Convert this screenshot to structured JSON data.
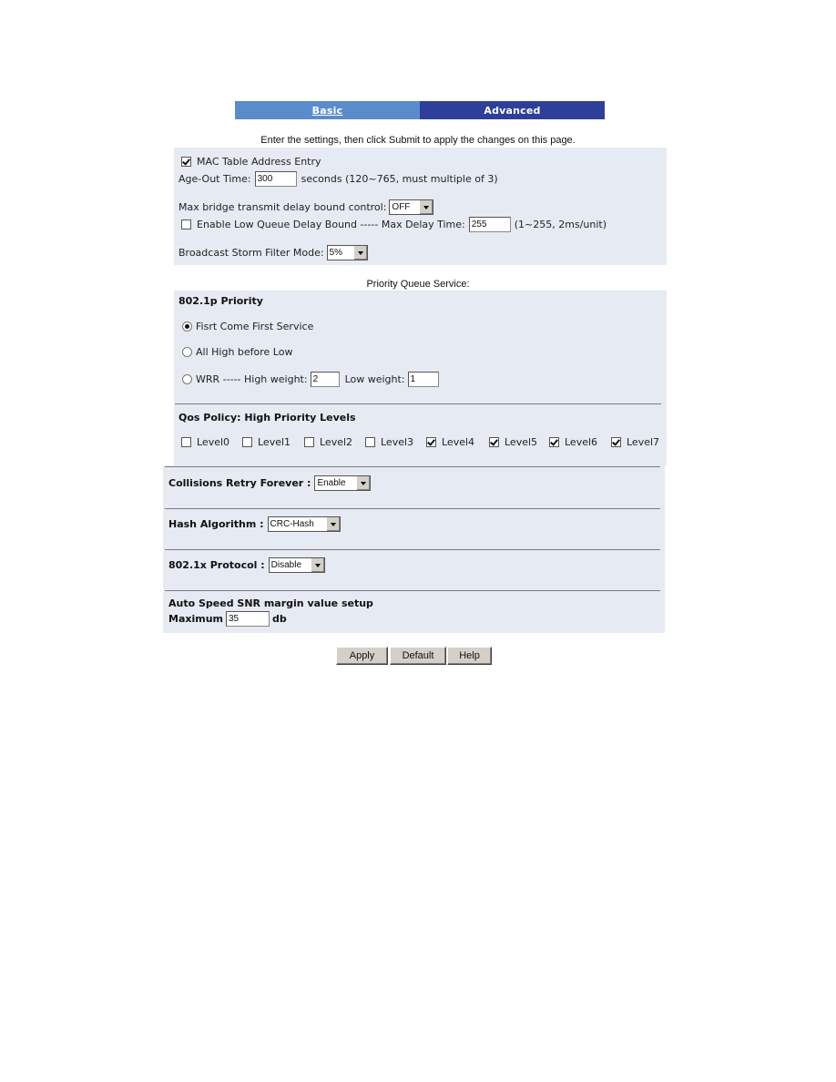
{
  "tabs": [
    {
      "label": "Basic",
      "active": false
    },
    {
      "label": "Advanced",
      "active": true
    }
  ],
  "colors": {
    "tab_basic": "#5a8ccc",
    "tab_advanced": "#2e3f99",
    "panel_bg": "#e6eaf2"
  },
  "intro": "Enter the settings, then click Submit to apply the changes on this page.",
  "general": {
    "mac_table_label": "MAC Table Address Entry",
    "mac_table_checked": true,
    "age_out_label": "Age-Out Time:",
    "age_out_value": "300",
    "age_out_hint": "seconds (120~765, must multiple of 3)",
    "max_bridge_label": "Max bridge transmit delay bound control:",
    "max_bridge_value": "OFF",
    "low_queue_label": "Enable Low Queue Delay Bound ----- Max Delay Time:",
    "low_queue_checked": false,
    "max_delay_value": "255",
    "max_delay_hint": "(1~255, 2ms/unit)",
    "broadcast_label": "Broadcast Storm Filter Mode:",
    "broadcast_value": "5%"
  },
  "priority_queue": {
    "caption": "Priority Queue Service:",
    "heading": "802.1p Priority",
    "options": [
      {
        "label": "Fisrt Come First Service",
        "selected": true
      },
      {
        "label": "All High before Low",
        "selected": false
      },
      {
        "label": "WRR ----- High weight:",
        "selected": false
      }
    ],
    "high_weight": "2",
    "low_weight_label": "Low weight:",
    "low_weight": "1",
    "qos_heading": "Qos Policy: High Priority Levels",
    "levels": [
      {
        "label": "Level0",
        "checked": false
      },
      {
        "label": "Level1",
        "checked": false
      },
      {
        "label": "Level2",
        "checked": false
      },
      {
        "label": "Level3",
        "checked": false
      },
      {
        "label": "Level4",
        "checked": true
      },
      {
        "label": "Level5",
        "checked": true
      },
      {
        "label": "Level6",
        "checked": true
      },
      {
        "label": "Level7",
        "checked": true
      }
    ]
  },
  "misc": {
    "collisions_label": "Collisions Retry Forever :",
    "collisions_value": "Enable",
    "hash_label": "Hash Algorithm :",
    "hash_value": "CRC-Hash",
    "dot1x_label": "802.1x Protocol :",
    "dot1x_value": "Disable",
    "snr_heading": "Auto Speed SNR margin value setup",
    "snr_max_label": "Maximum",
    "snr_max_value": "35",
    "snr_unit": "db"
  },
  "buttons": {
    "apply": "Apply",
    "default": "Default",
    "help": "Help"
  }
}
